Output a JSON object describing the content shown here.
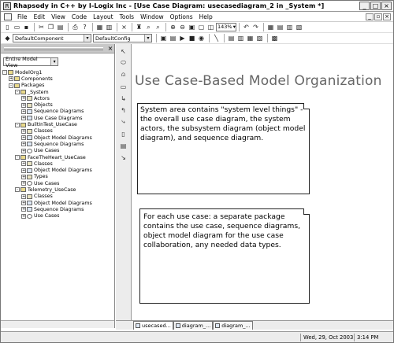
{
  "window": {
    "title": "Rhapsody in C++ by I-Logix Inc - [Use Case Diagram: usecasediagram_2 in _System *]",
    "app_icon": "rhapsody-app-icon"
  },
  "menu": {
    "items": [
      "File",
      "Edit",
      "View",
      "Code",
      "Layout",
      "Tools",
      "Window",
      "Options",
      "Help"
    ]
  },
  "toolbar": {
    "zoom": "143%",
    "component_combo": "DefaultComponent",
    "config_combo": "DefaultConfig"
  },
  "browser": {
    "view_combo": "Entire Model View",
    "tree": [
      {
        "label": "ModelOrg1",
        "level": 0,
        "exp": "-",
        "icon": "pkg"
      },
      {
        "label": "Components",
        "level": 1,
        "exp": "+",
        "icon": "pkg"
      },
      {
        "label": "Packages",
        "level": 1,
        "exp": "-",
        "icon": "pkg"
      },
      {
        "label": "_System",
        "level": 2,
        "exp": "-",
        "icon": "pkg"
      },
      {
        "label": "Actors",
        "level": 3,
        "exp": "+",
        "icon": "class"
      },
      {
        "label": "Objects",
        "level": 3,
        "exp": "+",
        "icon": "class"
      },
      {
        "label": "Sequence Diagrams",
        "level": 3,
        "exp": "+",
        "icon": "diag"
      },
      {
        "label": "Use Case Diagrams",
        "level": 3,
        "exp": "+",
        "icon": "diag"
      },
      {
        "label": "BuiltInTest_UseCase",
        "level": 2,
        "exp": "-",
        "icon": "pkg"
      },
      {
        "label": "Classes",
        "level": 3,
        "exp": "+",
        "icon": "class"
      },
      {
        "label": "Object Model Diagrams",
        "level": 3,
        "exp": "+",
        "icon": "diag"
      },
      {
        "label": "Sequence Diagrams",
        "level": 3,
        "exp": "+",
        "icon": "diag"
      },
      {
        "label": "Use Cases",
        "level": 3,
        "exp": "+",
        "icon": "uc"
      },
      {
        "label": "FaceTheHeart_UseCase",
        "level": 2,
        "exp": "-",
        "icon": "pkg"
      },
      {
        "label": "Classes",
        "level": 3,
        "exp": "+",
        "icon": "class"
      },
      {
        "label": "Object Model Diagrams",
        "level": 3,
        "exp": "+",
        "icon": "diag"
      },
      {
        "label": "Types",
        "level": 3,
        "exp": "+",
        "icon": "class"
      },
      {
        "label": "Use Cases",
        "level": 3,
        "exp": "+",
        "icon": "uc"
      },
      {
        "label": "Telemetry_UseCase",
        "level": 2,
        "exp": "-",
        "icon": "pkg"
      },
      {
        "label": "Classes",
        "level": 3,
        "exp": "+",
        "icon": "class"
      },
      {
        "label": "Object Model Diagrams",
        "level": 3,
        "exp": "+",
        "icon": "diag"
      },
      {
        "label": "Sequence Diagrams",
        "level": 3,
        "exp": "+",
        "icon": "diag"
      },
      {
        "label": "Use Cases",
        "level": 3,
        "exp": "+",
        "icon": "uc"
      }
    ]
  },
  "diagram": {
    "title": "Use Case-Based Model Organization",
    "note1": "System area contains \"system level things\" - the overall use case diagram, the system actors, the subsystem diagram (object model diagram), and sequence diagram.",
    "note2": "For each use case: a separate package contains the use case, sequence diagrams, object model diagram for the use case collaboration, any needed data types."
  },
  "tabs": [
    {
      "label": "usecased..."
    },
    {
      "label": "diagram_..."
    },
    {
      "label": "diagram_..."
    }
  ],
  "status": {
    "date": "Wed, 29, Oct 2003",
    "time": "3:14 PM"
  }
}
